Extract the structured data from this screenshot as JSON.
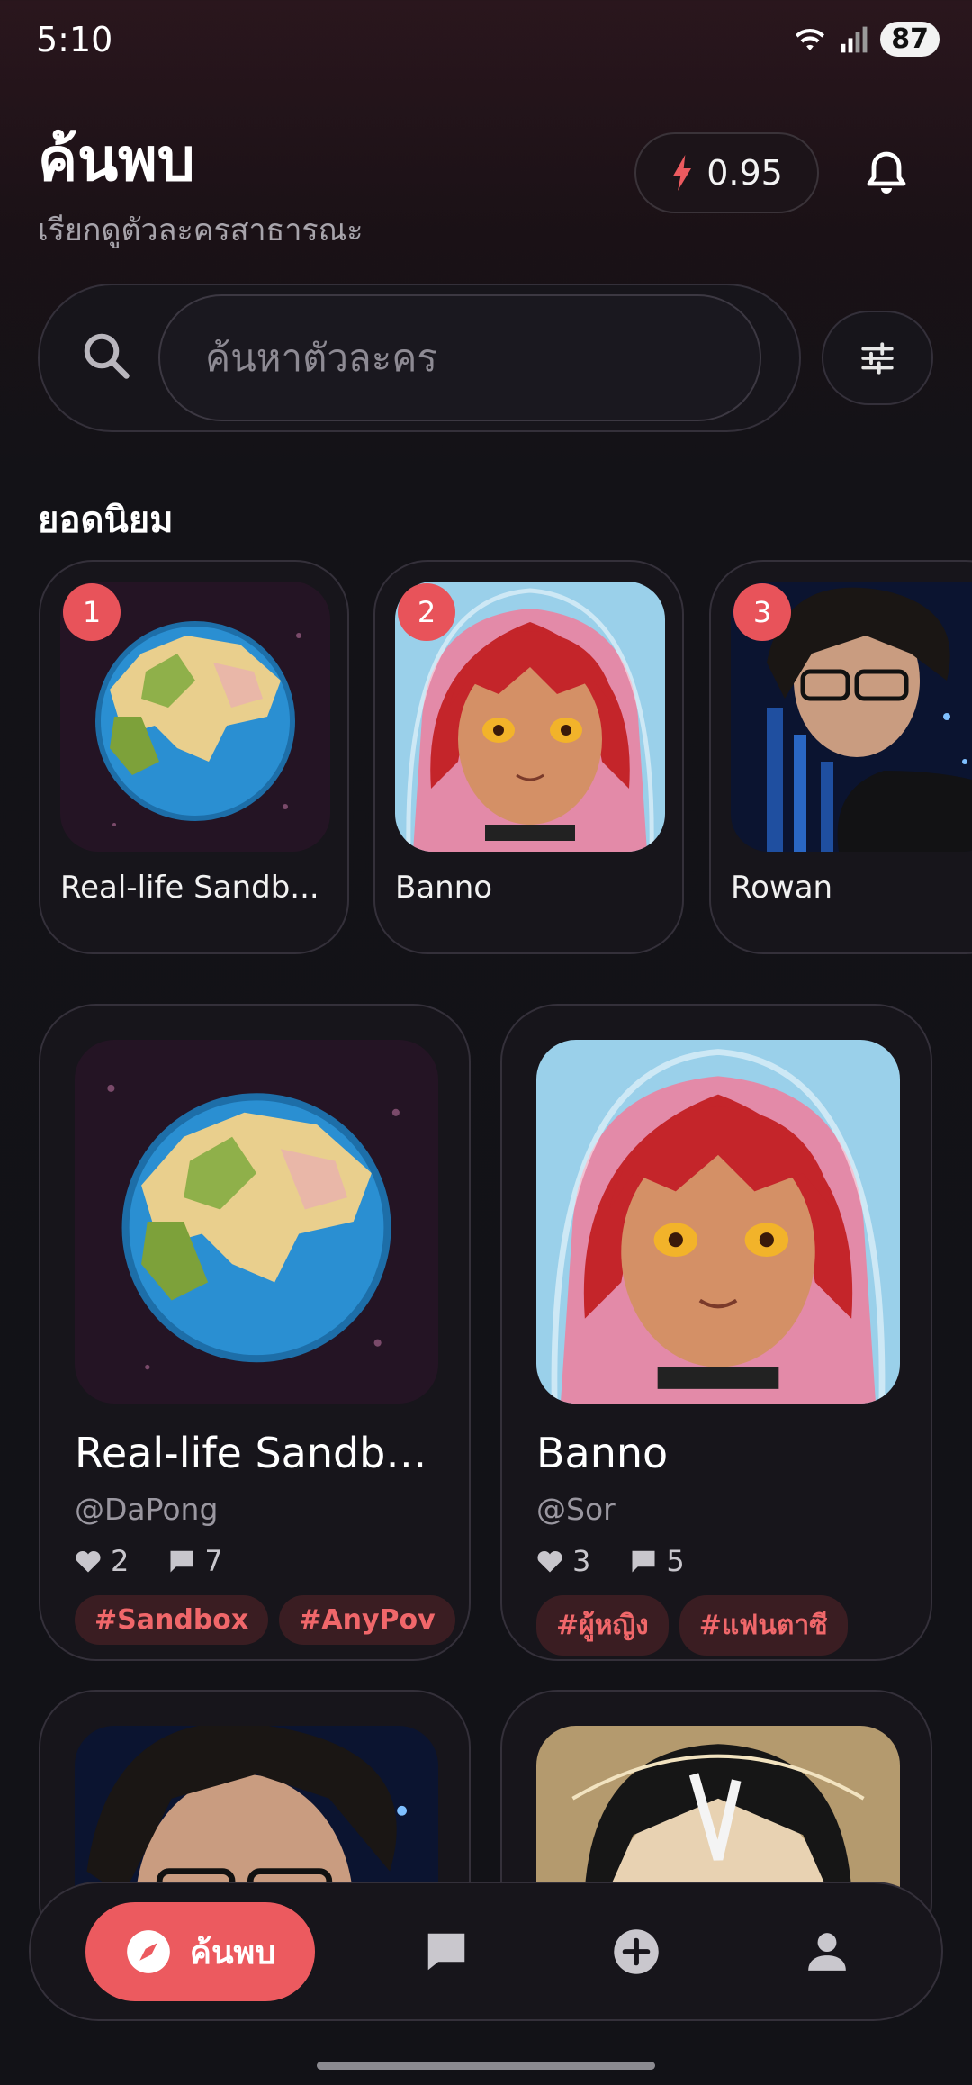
{
  "status_bar": {
    "time": "5:10",
    "battery": "87"
  },
  "header": {
    "title": "ค้นพบ",
    "subtitle": "เรียกดูตัวละครสาธารณะ",
    "credits": "0.95"
  },
  "search": {
    "placeholder": "ค้นหาตัวละคร"
  },
  "popular": {
    "title": "ยอดนิยม",
    "items": [
      {
        "rank": "1",
        "name": "Real-life Sandb..."
      },
      {
        "rank": "2",
        "name": "Banno"
      },
      {
        "rank": "3",
        "name": "Rowan"
      }
    ]
  },
  "grid": {
    "items": [
      {
        "name": "Real-life Sandbo...",
        "author": "@DaPong",
        "likes": "2",
        "comments": "7",
        "tags": [
          "#Sandbox",
          "#AnyPov"
        ]
      },
      {
        "name": "Banno",
        "author": "@Sor",
        "likes": "3",
        "comments": "5",
        "tags": [
          "#ผู้หญิง",
          "#แฟนตาซี"
        ]
      }
    ]
  },
  "nav": {
    "discover_label": "ค้นพบ"
  },
  "colors": {
    "accent": "#ec5a5f",
    "tag_bg": "#3a1d22",
    "tag_text": "#f0676a",
    "card_bg": "#17151b"
  }
}
